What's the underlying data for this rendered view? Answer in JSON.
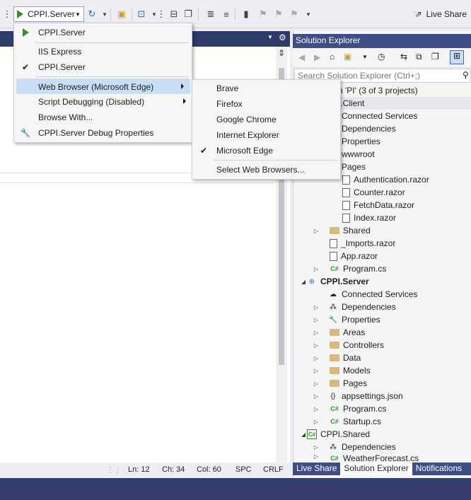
{
  "toolbar": {
    "run_target": "CPPI.Server",
    "live_share": "Live Share"
  },
  "run_menu": {
    "items": [
      {
        "label": "CPPI.Server",
        "icon": "play-icon"
      },
      {
        "label": "IIS Express"
      },
      {
        "label": "CPPI.Server",
        "checked": true
      },
      {
        "label": "Web Browser (Microsoft Edge)",
        "submenu": true,
        "highlighted": true
      },
      {
        "label": "Script Debugging (Disabled)",
        "submenu": true
      },
      {
        "label": "Browse With..."
      },
      {
        "label": "CPPI.Server Debug Properties",
        "icon": "wrench-icon"
      }
    ]
  },
  "browser_menu": {
    "items": [
      {
        "label": "Brave"
      },
      {
        "label": "Firefox"
      },
      {
        "label": "Google Chrome"
      },
      {
        "label": "Internet Explorer"
      },
      {
        "label": "Microsoft Edge",
        "checked": true
      },
      {
        "label": "Select Web Browsers..."
      }
    ]
  },
  "solution_explorer": {
    "title": "Solution Explorer",
    "search_placeholder": "Search Solution Explorer (Ctrl+;)",
    "tree": [
      {
        "label": "n 'PI' (3 of 3 projects)"
      },
      {
        "label": "I.Client"
      },
      {
        "label": "Connected Services"
      },
      {
        "label": "Dependencies"
      },
      {
        "label": "Properties"
      },
      {
        "label": "wwwroot"
      },
      {
        "label": "Pages"
      },
      {
        "label": "Authentication.razor"
      },
      {
        "label": "Counter.razor"
      },
      {
        "label": "FetchData.razor"
      },
      {
        "label": "Index.razor"
      },
      {
        "label": "Shared"
      },
      {
        "label": "_Imports.razor"
      },
      {
        "label": "App.razor"
      },
      {
        "label": "Program.cs"
      },
      {
        "label": "CPPI.Server"
      },
      {
        "label": "Connected Services"
      },
      {
        "label": "Dependencies"
      },
      {
        "label": "Properties"
      },
      {
        "label": "Areas"
      },
      {
        "label": "Controllers"
      },
      {
        "label": "Data"
      },
      {
        "label": "Models"
      },
      {
        "label": "Pages"
      },
      {
        "label": "appsettings.json"
      },
      {
        "label": "Program.cs"
      },
      {
        "label": "Startup.cs"
      },
      {
        "label": "CPPI.Shared"
      },
      {
        "label": "Dependencies"
      },
      {
        "label": "WeatherForecast.cs"
      }
    ],
    "tabs": [
      "Live Share",
      "Solution Explorer",
      "Notifications"
    ]
  },
  "statusbar": {
    "ln": "Ln: 12",
    "ch": "Ch: 34",
    "col": "Col: 60",
    "spc": "SPC",
    "crlf": "CRLF"
  },
  "colors": {
    "accent_dark": "#343d6e",
    "panel_title": "#3e4d85",
    "menu_highlight": "#c9def5",
    "run_green": "#388a34"
  }
}
